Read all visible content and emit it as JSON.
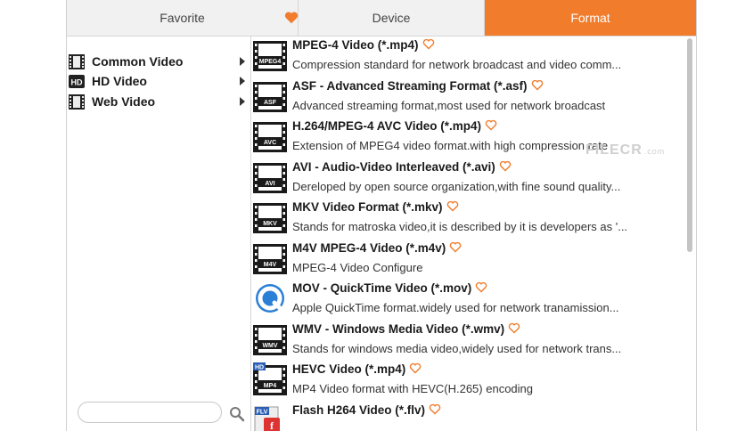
{
  "tabs": {
    "favorite": "Favorite",
    "device": "Device",
    "format": "Format"
  },
  "categories": [
    {
      "label": "Common Video",
      "icon": "film-icon"
    },
    {
      "label": "HD Video",
      "icon": "hd-icon"
    },
    {
      "label": "Web Video",
      "icon": "film-icon"
    }
  ],
  "search": {
    "placeholder": "",
    "value": ""
  },
  "formats": [
    {
      "title": "MPEG-4 Video (*.mp4)",
      "desc": "Compression standard for network broadcast and video comm...",
      "badge": "MPEG4"
    },
    {
      "title": "ASF - Advanced Streaming Format (*.asf)",
      "desc": "Advanced streaming format,most used for network broadcast",
      "badge": "ASF"
    },
    {
      "title": "H.264/MPEG-4 AVC Video (*.mp4)",
      "desc": "Extension of MPEG4 video format.with high compression rate",
      "badge": "AVC"
    },
    {
      "title": "AVI - Audio-Video Interleaved (*.avi)",
      "desc": "Dereloped by open source organization,with fine sound quality...",
      "badge": "AVI"
    },
    {
      "title": "MKV Video Format (*.mkv)",
      "desc": "Stands for matroska video,it is described by it is developers as '...",
      "badge": "MKV"
    },
    {
      "title": "M4V MPEG-4 Video (*.m4v)",
      "desc": "MPEG-4 Video Configure",
      "badge": "M4V"
    },
    {
      "title": "MOV - QuickTime Video (*.mov)",
      "desc": "Apple QuickTime format.widely used for network tranamission...",
      "badge": "Q"
    },
    {
      "title": "WMV - Windows Media Video (*.wmv)",
      "desc": "Stands for windows media video,widely used for network trans...",
      "badge": "WMV"
    },
    {
      "title": "HEVC Video (*.mp4)",
      "desc": "MP4 Video format with HEVC(H.265) encoding",
      "badge": "MP4"
    },
    {
      "title": "Flash H264 Video (*.flv)",
      "desc": "",
      "badge": "FLV"
    }
  ],
  "watermark": {
    "text": "FILECR",
    "suffix": ".com"
  },
  "colors": {
    "accent": "#f07c2c",
    "heart": "#f07c2c"
  }
}
